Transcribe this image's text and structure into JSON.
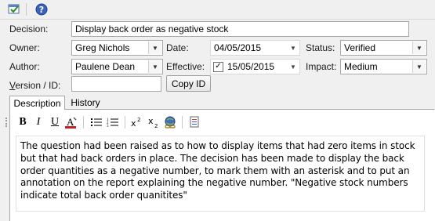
{
  "toolbar": {
    "icons": [
      "properties-icon",
      "help-icon"
    ]
  },
  "form": {
    "decision_label": "Decision:",
    "decision_value": "Display back order as negative stock",
    "owner_label": "Owner:",
    "owner_value": "Greg Nichols",
    "date_label": "Date:",
    "date_value": "04/05/2015",
    "status_label": "Status:",
    "status_value": "Verified",
    "author_label": "Author:",
    "author_value": "Paulene Dean",
    "effective_label": "Effective:",
    "effective_value": "15/05/2015",
    "effective_checked": true,
    "impact_label": "Impact:",
    "impact_value": "Medium",
    "version_label": "Version / ID:",
    "version_value": "",
    "copy_id_label": "Copy ID"
  },
  "tabs": [
    {
      "label": "Description",
      "active": true
    },
    {
      "label": "History",
      "active": false
    }
  ],
  "format_toolbar": {
    "bold": "B",
    "italic": "I",
    "underline": "U",
    "font_color_icon": "font-color-icon",
    "bullet_list_icon": "bullet-list-icon",
    "numbered_list_icon": "numbered-list-icon",
    "superscript_icon": "superscript-icon",
    "subscript_icon": "subscript-icon",
    "hyperlink_icon": "hyperlink-icon",
    "document_icon": "document-icon"
  },
  "description_text": "The question had been raised as to how to display items that had zero items in stock but that had back orders in place. The decision has been made to display the back order quantities as a negative number, to mark them with an asterisk and to put an annotation on the report explaining the negative number. \"Negative stock numbers indicate total back order quanitites\""
}
